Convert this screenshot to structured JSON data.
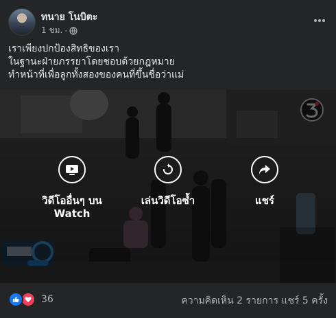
{
  "post": {
    "author": "ทนาย โนบิตะ",
    "time": "1 ชม.",
    "separator": "·",
    "more_icon": "more-dots-icon",
    "caption": [
      "เราเพียงปกป้องสิทธิของเรา",
      "ในฐานะฝ่ายภรรยาโดยชอบด้วยกฎหมาย",
      "ทำหน้าที่เพื่อลูกทั้งสองของคนที่ขึ้นชื่อว่าแม่"
    ]
  },
  "video": {
    "actions": [
      {
        "label": "วิดีโออื่นๆ บน",
        "label2": "Watch",
        "icon": "watch-video-icon"
      },
      {
        "label": "เล่นวิดีโอซ้ำ",
        "icon": "replay-icon"
      },
      {
        "label": "แชร์",
        "icon": "share-arrow-icon"
      }
    ],
    "channel_logo": "channel-3-logo",
    "news_logo": "news-program-logo"
  },
  "footer": {
    "reaction_count": "36",
    "comments": "ความคิดเห็น 2 รายการ",
    "shares": "แชร์ 5 ครั้ง"
  },
  "colors": {
    "background": "#242526",
    "text": "#e4e6eb",
    "secondary_text": "#b0b3b8",
    "like_blue": "#1877f2",
    "love_red": "#f33e58"
  }
}
